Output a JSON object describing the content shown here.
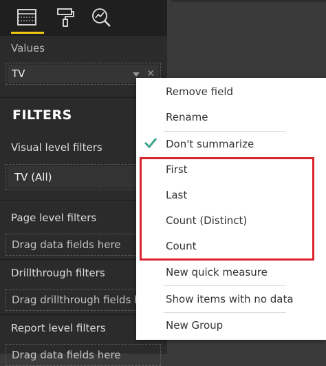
{
  "colors": {
    "accent": "#f2c811",
    "highlight": "#d9232e",
    "check": "#3fa58b"
  },
  "tabs": [
    {
      "icon": "fields-table-icon",
      "active": true
    },
    {
      "icon": "format-paint-roller-icon",
      "active": false
    },
    {
      "icon": "analytics-magnifier-icon",
      "active": false
    }
  ],
  "values_section": {
    "label": "Values",
    "field": "TV"
  },
  "filters": {
    "title": "FILTERS",
    "visual_level_label": "Visual level filters",
    "visual_filter_card": "TV  (All)",
    "page_level_label": "Page level filters",
    "page_drop": "Drag data fields here",
    "drillthrough_label": "Drillthrough filters",
    "drillthrough_drop": "Drag drillthrough fields here",
    "report_level_label": "Report level filters",
    "report_drop": "Drag data fields here"
  },
  "context_menu": {
    "items": [
      {
        "label": "Remove field"
      },
      {
        "label": "Rename"
      },
      {
        "label": "Don't summarize",
        "checked": true
      },
      {
        "label": "First"
      },
      {
        "label": "Last"
      },
      {
        "label": "Count (Distinct)"
      },
      {
        "label": "Count"
      },
      {
        "label": "New quick measure"
      },
      {
        "label": "Show items with no data"
      },
      {
        "label": "New Group"
      }
    ]
  }
}
